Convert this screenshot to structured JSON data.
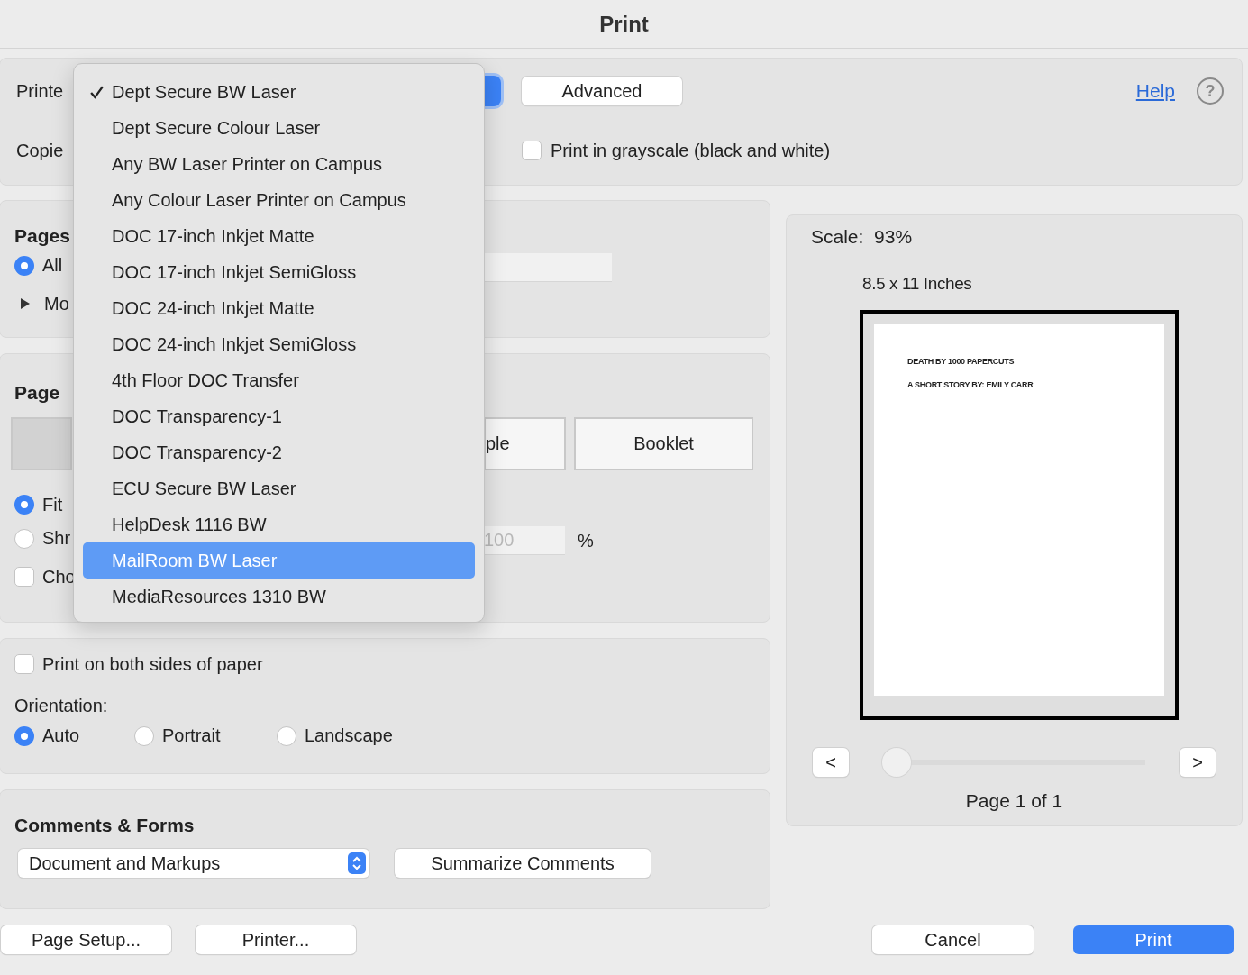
{
  "window": {
    "title": "Print"
  },
  "printer": {
    "label": "Printe",
    "advanced_button": "Advanced",
    "help_link": "Help",
    "help_button": "?"
  },
  "copies": {
    "label": "Copie",
    "grayscale": {
      "label": "Print in grayscale (black and white)",
      "checked": false
    }
  },
  "pages": {
    "heading": "Pages",
    "options": [
      {
        "label": "All",
        "selected": true
      }
    ],
    "more": {
      "label": "Mo",
      "expanded": false
    }
  },
  "page_sizing": {
    "heading": "Page",
    "segments": [
      {
        "selected": true
      },
      {
        "label": "ple",
        "selected": false
      },
      {
        "label": "Booklet",
        "selected": false
      }
    ],
    "options": [
      {
        "label": "Fit",
        "selected": true
      },
      {
        "label": "Shr",
        "selected": false
      }
    ],
    "scale_field": {
      "value": "100",
      "disabled": true
    },
    "percent": "%",
    "choose_checkbox": {
      "label": "Cho",
      "checked": false
    }
  },
  "duplex": {
    "label": "Print on both sides of paper",
    "checked": false
  },
  "orientation": {
    "label": "Orientation:",
    "options": [
      {
        "label": "Auto",
        "selected": true
      },
      {
        "label": "Portrait",
        "selected": false
      },
      {
        "label": "Landscape",
        "selected": false
      }
    ]
  },
  "comments_forms": {
    "heading": "Comments & Forms",
    "select": "Document and Markups",
    "summarize_button": "Summarize Comments"
  },
  "preview": {
    "scale": "Scale:  93%",
    "paper_size": "8.5 x 11 Inches",
    "document_lines": [
      "DEATH BY 1000 PAPERCUTS",
      "A SHORT STORY BY: EMILY CARR"
    ],
    "page_slider": {
      "level": 0
    },
    "prev_button": "<",
    "next_button": ">",
    "page_status": "Page 1 of 1"
  },
  "buttons": {
    "page_setup": "Page Setup...",
    "printer": "Printer...",
    "cancel": "Cancel",
    "print": "Print"
  },
  "printer_menu": {
    "items": [
      {
        "label": "Dept Secure BW Laser",
        "checked": true,
        "selected": false
      },
      {
        "label": "Dept Secure Colour Laser",
        "checked": false,
        "selected": false
      },
      {
        "label": "Any BW Laser Printer on Campus",
        "checked": false,
        "selected": false
      },
      {
        "label": "Any Colour Laser Printer on Campus",
        "checked": false,
        "selected": false
      },
      {
        "label": "DOC 17-inch Inkjet Matte",
        "checked": false,
        "selected": false
      },
      {
        "label": "DOC 17-inch Inkjet SemiGloss",
        "checked": false,
        "selected": false
      },
      {
        "label": "DOC 24-inch Inkjet Matte",
        "checked": false,
        "selected": false
      },
      {
        "label": "DOC 24-inch Inkjet SemiGloss",
        "checked": false,
        "selected": false
      },
      {
        "label": "4th Floor DOC Transfer",
        "checked": false,
        "selected": false
      },
      {
        "label": "DOC Transparency-1",
        "checked": false,
        "selected": false
      },
      {
        "label": "DOC Transparency-2",
        "checked": false,
        "selected": false
      },
      {
        "label": "ECU Secure BW Laser",
        "checked": false,
        "selected": false
      },
      {
        "label": "HelpDesk 1116 BW",
        "checked": false,
        "selected": false
      },
      {
        "label": "MailRoom BW Laser",
        "checked": false,
        "selected": true
      },
      {
        "label": "MediaResources 1310 BW",
        "checked": false,
        "selected": false
      }
    ]
  }
}
